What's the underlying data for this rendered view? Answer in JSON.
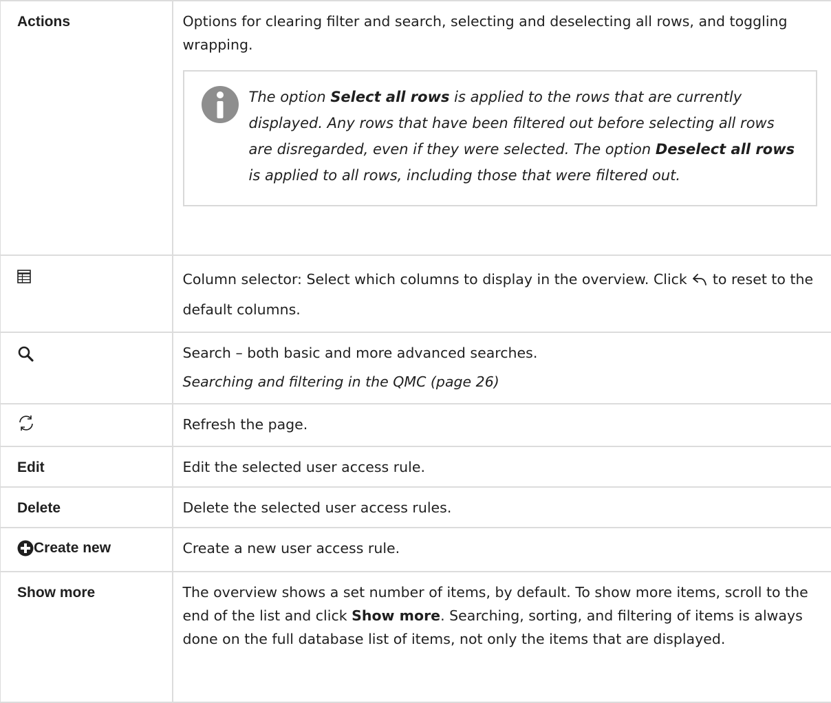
{
  "rows": {
    "actions": {
      "label": "Actions",
      "text": "Options for clearing filter and search, selecting and deselecting all rows, and toggling wrapping.",
      "note": {
        "p1": "The option ",
        "b1": "Select all rows",
        "p2": " is applied to the rows that are currently displayed. Any rows that have been filtered out before selecting all rows are disregarded, even if they were selected. The option ",
        "b2": "Deselect all rows",
        "p3": " is applied to all rows, including those that were filtered out."
      }
    },
    "column_selector": {
      "icon": "table-icon",
      "text_a": "Column selector: Select which columns to display in the overview. Click ",
      "undo_icon": "undo-arrow-icon",
      "text_b": " to reset to the default columns."
    },
    "search": {
      "icon": "search-icon",
      "text": "Search – both basic and more advanced searches.",
      "link": " Searching and filtering in the QMC (page 26)"
    },
    "refresh": {
      "icon": "refresh-icon",
      "text": "Refresh the page."
    },
    "edit": {
      "label": "Edit",
      "text": "Edit the selected user access rule."
    },
    "delete": {
      "label": "Delete",
      "text": "Delete the selected user access rules."
    },
    "create": {
      "icon": "plus-circle-icon",
      "label": "Create new",
      "text": "Create a new user access rule."
    },
    "show_more": {
      "label": "Show more",
      "t1": "The overview shows a set number of items, by default. To show more items, scroll to the end of the list and click ",
      "b1": "Show more",
      "t2": ". Searching, sorting, and filtering of items is always done on the full database list of items, not only the items that are displayed."
    }
  }
}
